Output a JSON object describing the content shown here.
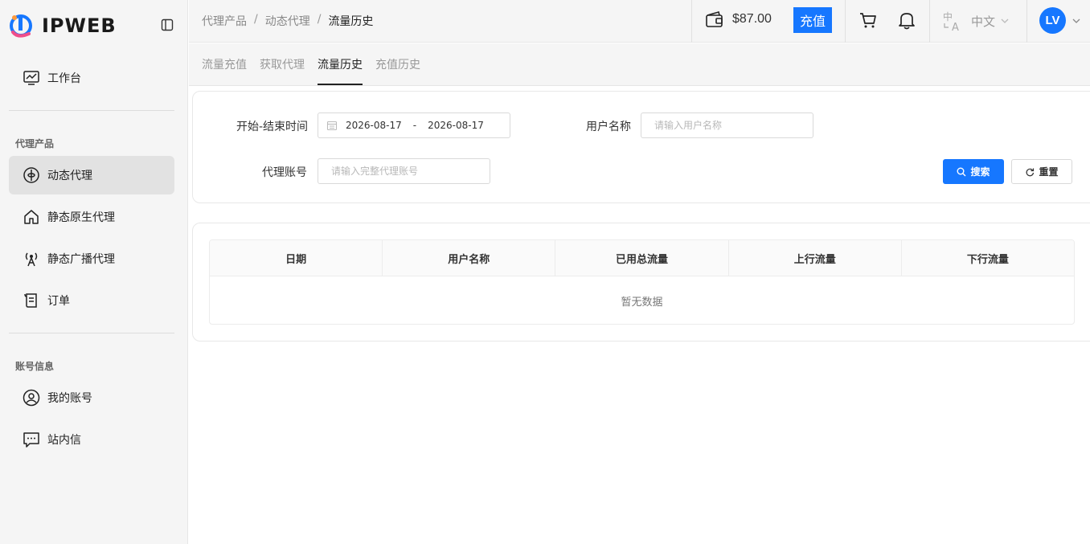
{
  "brand": {
    "name": "IPWEB",
    "accent": "#1677ff"
  },
  "sidebar": {
    "workspace": {
      "label": "工作台",
      "icon": "monitor-chart-icon"
    },
    "section_proxy": "代理产品",
    "items": [
      {
        "label": "动态代理",
        "icon": "globe-orbit-icon",
        "active": true
      },
      {
        "label": "静态原生代理",
        "icon": "house-icon"
      },
      {
        "label": "静态广播代理",
        "icon": "antenna-icon"
      },
      {
        "label": "订单",
        "icon": "scroll-document-icon"
      }
    ],
    "section_account": "账号信息",
    "account_items": [
      {
        "label": "我的账号",
        "icon": "user-circle-icon"
      },
      {
        "label": "站内信",
        "icon": "message-dots-icon"
      }
    ]
  },
  "header": {
    "breadcrumb": [
      "代理产品",
      "动态代理",
      "流量历史"
    ],
    "balance": "$87.00",
    "recharge_label": "充值",
    "language": "中文",
    "avatar_initials": "LV"
  },
  "tabs": [
    {
      "label": "流量充值"
    },
    {
      "label": "获取代理"
    },
    {
      "label": "流量历史",
      "active": true
    },
    {
      "label": "充值历史"
    }
  ],
  "filters": {
    "date_label": "开始-结束时间",
    "date_start": "2026-08-17",
    "date_sep": "-",
    "date_end": "2026-08-17",
    "username_label": "用户名称",
    "username_placeholder": "请输入用户名称",
    "account_label": "代理账号",
    "account_placeholder": "请输入完整代理账号",
    "search_label": "搜索",
    "reset_label": "重置"
  },
  "table": {
    "columns": [
      "日期",
      "用户名称",
      "已用总流量",
      "上行流量",
      "下行流量"
    ],
    "empty_text": "暂无数据"
  }
}
